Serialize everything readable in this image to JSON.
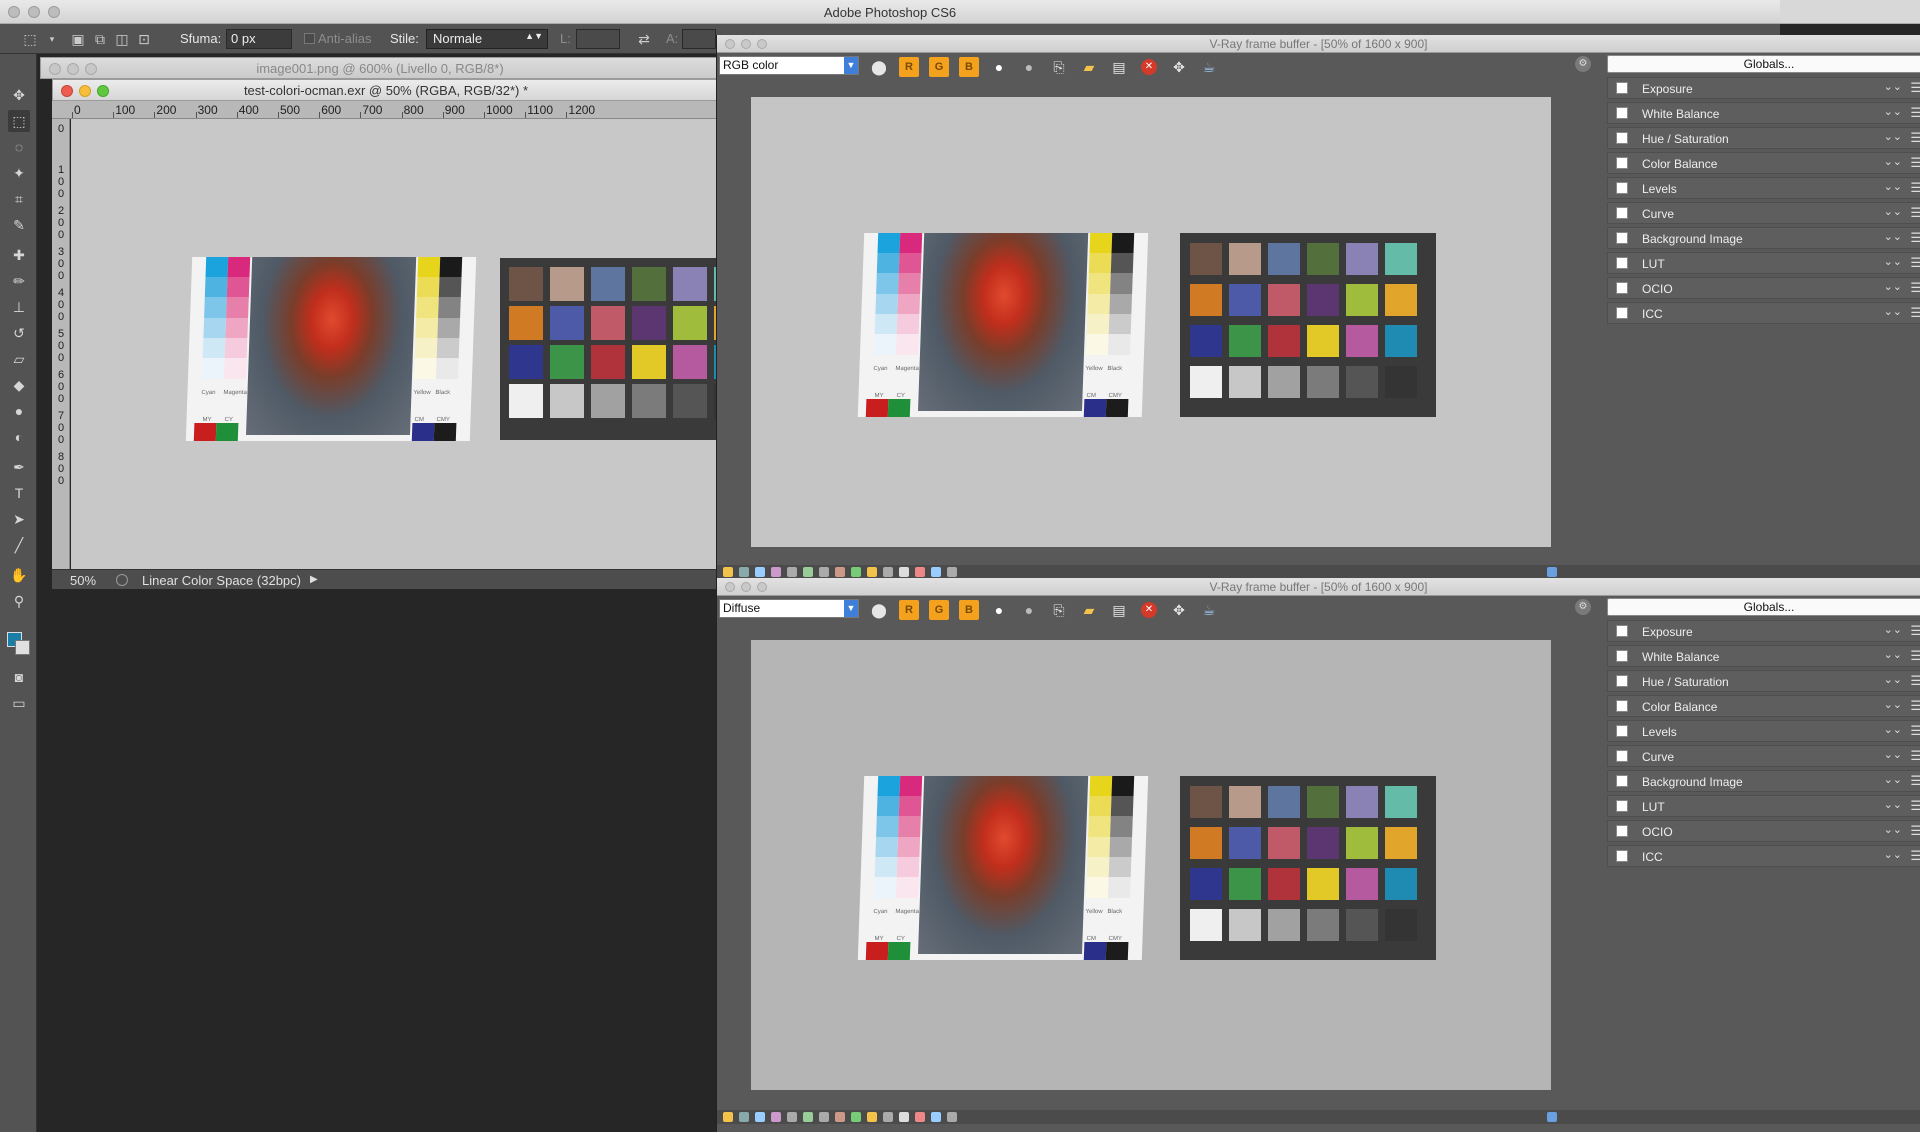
{
  "app": {
    "title": "Adobe Photoshop CS6"
  },
  "options_bar": {
    "feather_label": "Sfuma:",
    "feather_value": "0 px",
    "antialias_label": "Anti-alias",
    "style_label": "Stile:",
    "style_value": "Normale",
    "width_label": "L:",
    "height_label": "A:"
  },
  "toolbar": {
    "tools": [
      "move-tool-icon",
      "marquee-tool-icon",
      "lasso-tool-icon",
      "magic-wand-icon",
      "crop-tool-icon",
      "eyedropper-icon",
      "healing-brush-icon",
      "brush-tool-icon",
      "clone-stamp-icon",
      "history-brush-icon",
      "eraser-icon",
      "paint-bucket-icon",
      "blur-tool-icon",
      "dodge-tool-icon",
      "pen-tool-icon",
      "type-tool-icon",
      "path-select-icon",
      "line-tool-icon",
      "hand-tool-icon",
      "zoom-tool-icon"
    ]
  },
  "documents": {
    "back_title": "image001.png @ 600% (Livello 0, RGB/8*)",
    "front_title": "test-colori-ocman.exr @ 50% (RGBA, RGB/32*) *",
    "ruler_h": [
      "0",
      "100",
      "200",
      "300",
      "400",
      "500",
      "600",
      "700",
      "800",
      "900",
      "1000",
      "1100",
      "1200"
    ],
    "ruler_v": [
      "0",
      "100",
      "200",
      "300",
      "400",
      "500",
      "600",
      "700",
      "800"
    ],
    "zoom": "50%",
    "color_space": "Linear Color Space (32bpc)"
  },
  "vfb_top": {
    "title": "V-Ray frame buffer - [50% of 1600 x 900]",
    "channel": "RGB color",
    "globals": "Globals...",
    "layers": [
      "Exposure",
      "White Balance",
      "Hue / Saturation",
      "Color Balance",
      "Levels",
      "Curve",
      "Background Image",
      "LUT",
      "OCIO",
      "ICC"
    ]
  },
  "vfb_bottom": {
    "title": "V-Ray frame buffer - [50% of 1600 x 900]",
    "channel": "Diffuse",
    "globals": "Globals...",
    "layers": [
      "Exposure",
      "White Balance",
      "Hue / Saturation",
      "Color Balance",
      "Levels",
      "Curve",
      "Background Image",
      "LUT",
      "OCIO",
      "ICC"
    ]
  },
  "vfb_buttons": {
    "r": "R",
    "g": "G",
    "b": "B"
  },
  "photo_card": {
    "left_labels": [
      "Cyan",
      "Magenta"
    ],
    "right_labels": [
      "Yellow",
      "Black"
    ],
    "bottom_left": [
      "MY",
      "CY"
    ],
    "bottom_right": [
      "CM",
      "CMY"
    ]
  },
  "colors": {
    "checker_row1": [
      "#6e5446",
      "#b89a8a",
      "#5e75a0",
      "#53703c",
      "#8a82b5",
      "#63bba8"
    ],
    "checker_row2": [
      "#d07a24",
      "#4c5aa8",
      "#c05a68",
      "#5b3670",
      "#9fbc3c",
      "#e0a52a"
    ],
    "checker_row3": [
      "#2f368d",
      "#3b9448",
      "#b0323a",
      "#e3c927",
      "#b65aa0",
      "#1f8ab2"
    ],
    "checker_row4": [
      "#efefef",
      "#c7c7c7",
      "#a1a1a1",
      "#7b7b7b",
      "#555555",
      "#343434"
    ],
    "cyan_strip": [
      "#1aa3dd",
      "#4fb3e2",
      "#7dc6ea",
      "#a7d7f0",
      "#cfe8f6",
      "#eaf4fa"
    ],
    "magenta_strip": [
      "#d9297d",
      "#e05593",
      "#e77fab",
      "#eea6c3",
      "#f5cbdd",
      "#fae6ee"
    ],
    "yellow_strip": [
      "#e7d51c",
      "#ecdc55",
      "#f0e47f",
      "#f4eba6",
      "#f7f1c8",
      "#fbf8e6"
    ],
    "black_strip": [
      "#1a1a1a",
      "#555555",
      "#838383",
      "#a9a9a9",
      "#cbcbcb",
      "#e9e9e9"
    ]
  }
}
